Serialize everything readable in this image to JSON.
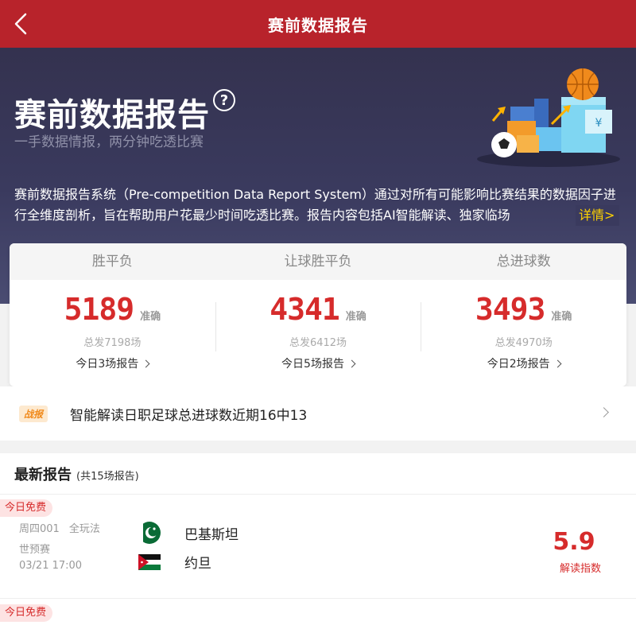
{
  "nav": {
    "title": "赛前数据报告",
    "back_icon": "chevron-left-icon"
  },
  "hero": {
    "title": "赛前数据报告",
    "help_symbol": "?",
    "subtitle": "一手数据情报，两分钟吃透比赛",
    "description": "赛前数据报告系统（Pre-competition Data Report System）通过对所有可能影响比赛结果的数据因子进行全维度剖析，旨在帮助用户花最少时间吃透比赛。报告内容包括AI智能解读、独家临场",
    "more_label": "详情>"
  },
  "stats": {
    "columns": [
      {
        "header": "胜平负",
        "value": "5189",
        "accuracy_label": "准确",
        "total": "总发7198场",
        "today": "今日3场报告"
      },
      {
        "header": "让球胜平负",
        "value": "4341",
        "accuracy_label": "准确",
        "total": "总发6412场",
        "today": "今日5场报告"
      },
      {
        "header": "总进球数",
        "value": "3493",
        "accuracy_label": "准确",
        "total": "总发4970场",
        "today": "今日2场报告"
      }
    ]
  },
  "bulletin": {
    "tag": "战报",
    "text": "智能解读日职足球总进球数近期16中13"
  },
  "latest": {
    "title": "最新报告",
    "count": "(共15场报告)",
    "matches": [
      {
        "badge": "今日免费",
        "code": "周四001",
        "play": "全玩法",
        "league": "世预赛",
        "time": "03/21 17:00",
        "home": "巴基斯坦",
        "away": "约旦",
        "score": "5.9",
        "score_label": "解读指数"
      },
      {
        "badge": "今日免费"
      }
    ]
  },
  "colors": {
    "brand_red": "#b8232b",
    "accent_red": "#d62b2b",
    "link_yellow": "#ffd200",
    "hero_bg": "#3a3a5e"
  }
}
